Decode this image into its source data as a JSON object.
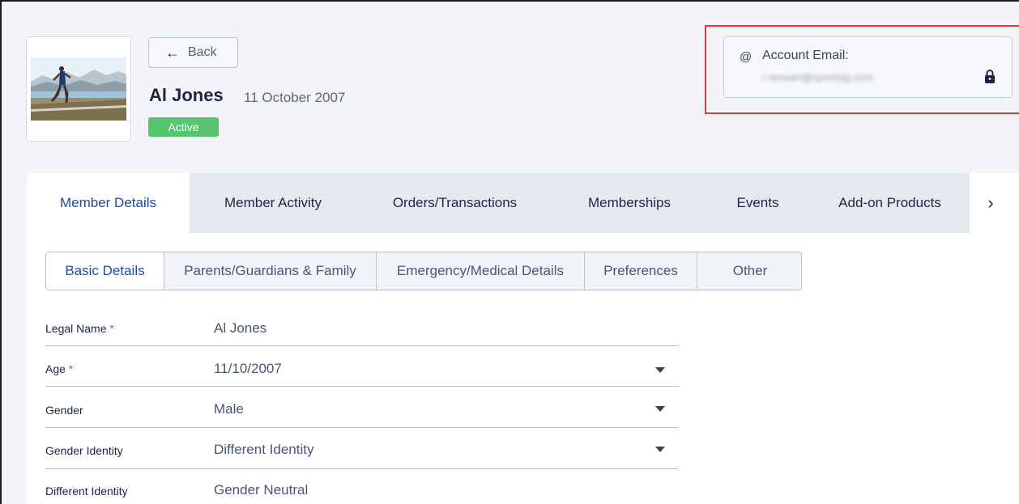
{
  "header": {
    "back_label": "Back",
    "member_name": "Al Jones",
    "member_dob": "11 October 2007",
    "status": "Active",
    "account_email_label": "Account Email:",
    "account_email_value": "r.stewart@sportstg.com"
  },
  "tabs": [
    {
      "label": "Member Details",
      "active": true
    },
    {
      "label": "Member Activity"
    },
    {
      "label": "Orders/Transactions"
    },
    {
      "label": "Memberships"
    },
    {
      "label": "Events"
    },
    {
      "label": "Add-on Products"
    }
  ],
  "subtabs": [
    {
      "label": "Basic Details",
      "active": true
    },
    {
      "label": "Parents/Guardians & Family"
    },
    {
      "label": "Emergency/Medical Details"
    },
    {
      "label": "Preferences"
    },
    {
      "label": "Other"
    }
  ],
  "fields": [
    {
      "label": "Legal Name",
      "required": "*",
      "value": "Al Jones"
    },
    {
      "label": "Age",
      "required": "*",
      "value": "11/10/2007",
      "dropdown": true
    },
    {
      "label": "Gender",
      "value": "Male",
      "dropdown": true
    },
    {
      "label": "Gender Identity",
      "value": "Different Identity",
      "dropdown": true
    },
    {
      "label": "Different Identity",
      "value": "Gender Neutral"
    }
  ],
  "icons": {
    "back": "arrow-left-icon",
    "email": "at-sign-icon",
    "lock": "lock-icon",
    "more_tabs": "chevron-right-icon",
    "dropdown": "caret-down-icon"
  },
  "colors": {
    "accent": "#1f4aa8",
    "status_active": "#56c46e",
    "highlight": "#e23a3a",
    "required": "#e0434b"
  }
}
